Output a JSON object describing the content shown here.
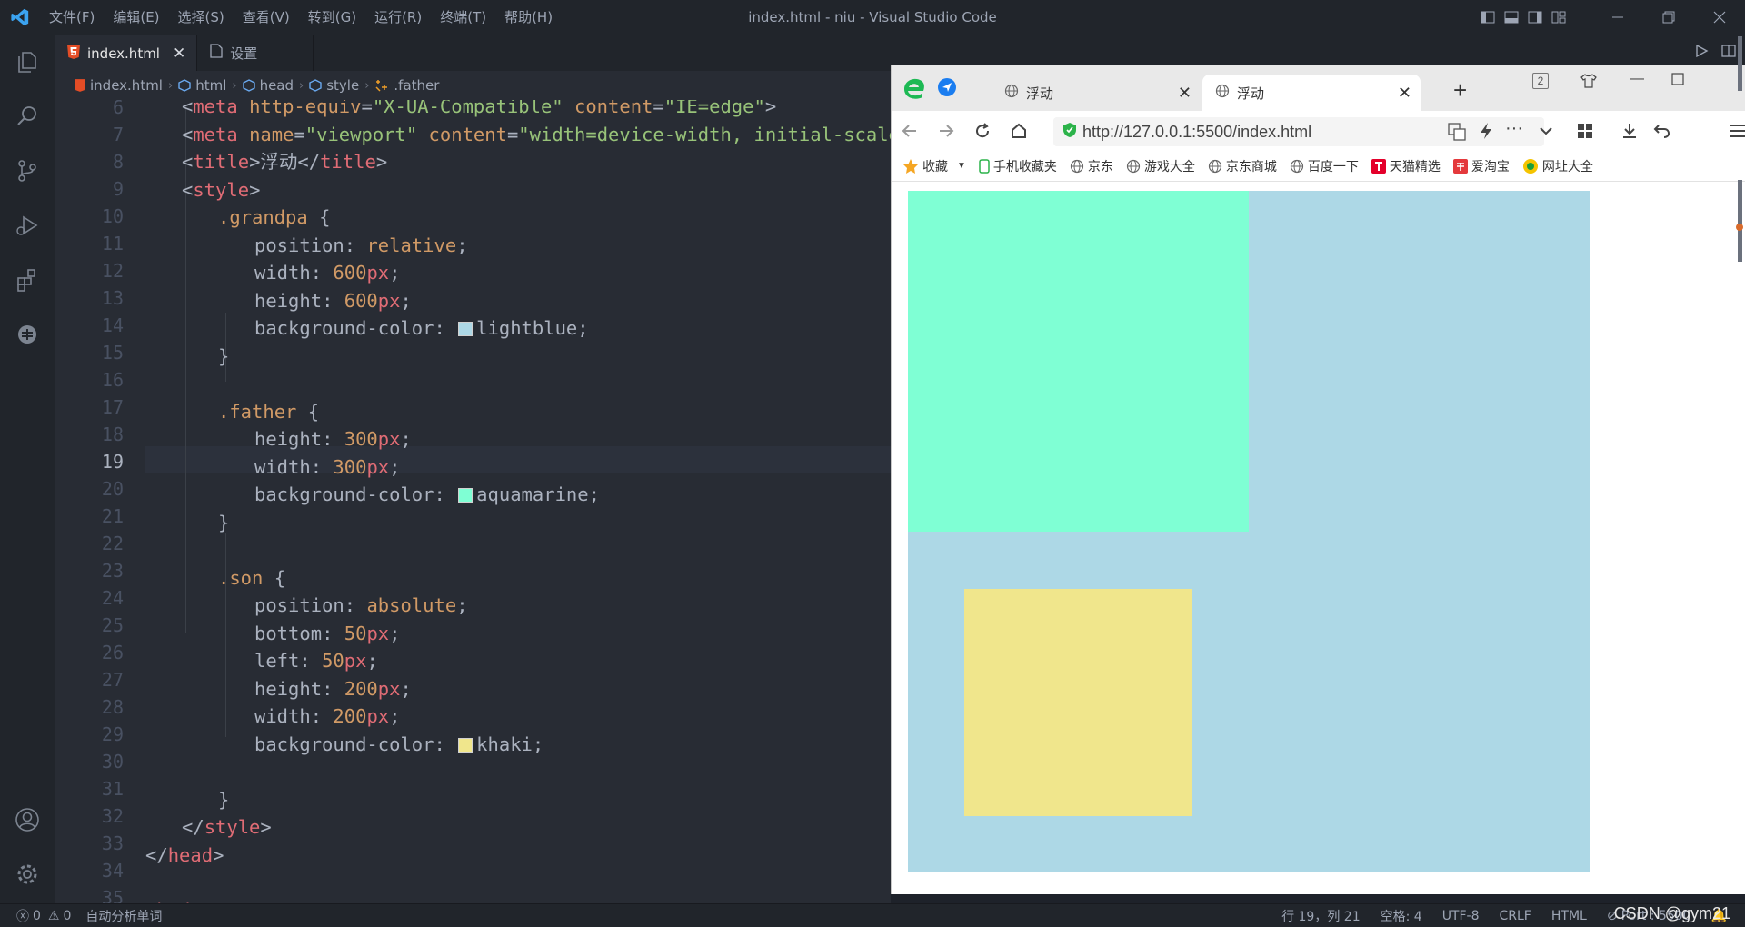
{
  "window": {
    "title": "index.html - niu - Visual Studio Code",
    "menu": [
      "文件(F)",
      "编辑(E)",
      "选择(S)",
      "查看(V)",
      "转到(G)",
      "运行(R)",
      "终端(T)",
      "帮助(H)"
    ]
  },
  "tabs": [
    {
      "label": "index.html",
      "active": true
    },
    {
      "label": "设置",
      "active": false
    }
  ],
  "breadcrumb": [
    "index.html",
    "html",
    "head",
    "style",
    ".father"
  ],
  "editor": {
    "current_line": 19,
    "line_numbers": [
      "6",
      "7",
      "8",
      "9",
      "10",
      "11",
      "12",
      "13",
      "14",
      "15",
      "16",
      "17",
      "18",
      "19",
      "20",
      "21",
      "22",
      "23",
      "24",
      "25",
      "26",
      "27",
      "28",
      "29",
      "30",
      "31",
      "32",
      "33",
      "34",
      "35"
    ],
    "swatch_colors": [
      "#add8e6",
      "#7fffd4",
      "#f0e68c"
    ]
  },
  "browser": {
    "tabs": [
      {
        "label": "浮动",
        "active": false
      },
      {
        "label": "浮动",
        "active": true
      }
    ],
    "tab_count_badge": "2",
    "url": "http://127.0.0.1:5500/index.html",
    "bookmarks": [
      "收藏",
      "手机收藏夹",
      "京东",
      "游戏大全",
      "京东商城",
      "百度一下",
      "天猫精选",
      "爱淘宝",
      "网址大全"
    ]
  },
  "statusbar": {
    "errors": "0",
    "warnings": "0",
    "left_text": "自动分析单词",
    "position": "行 19，列 21",
    "spaces": "空格: 4",
    "encoding": "UTF-8",
    "eol": "CRLF",
    "language": "HTML",
    "port": "Port : 5500"
  },
  "watermark": "CSDN @gym21"
}
